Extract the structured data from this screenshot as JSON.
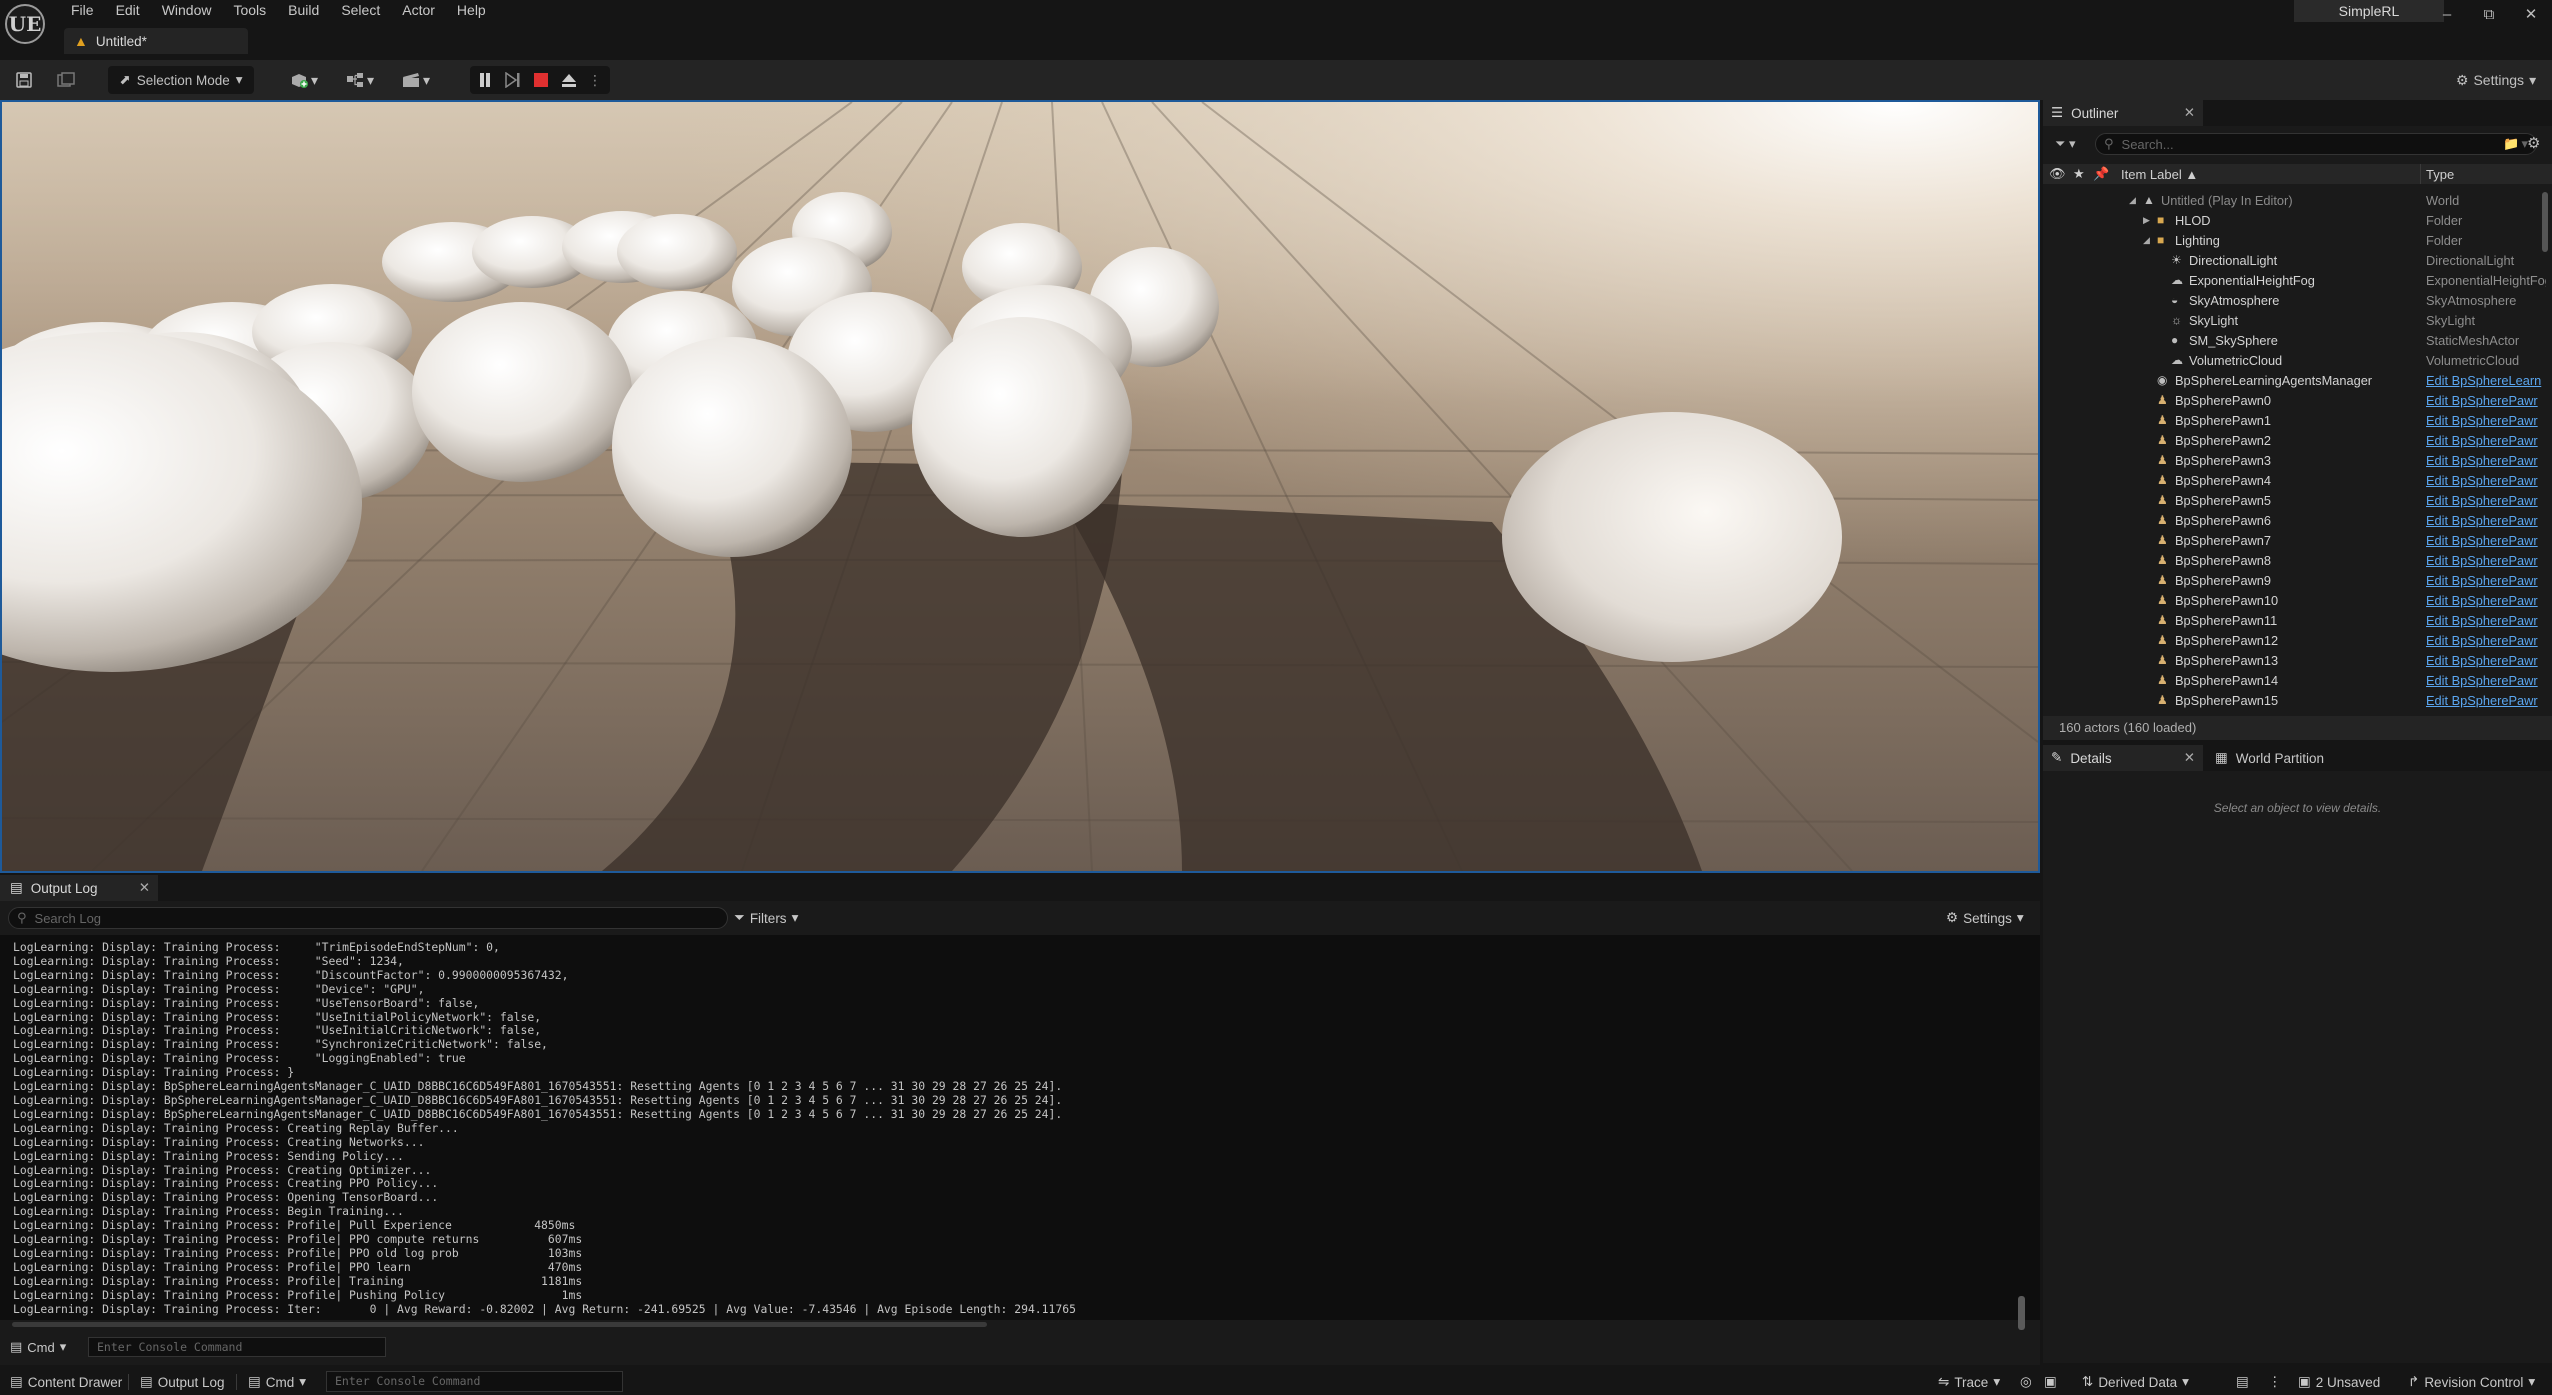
{
  "app": {
    "logo": "UE",
    "project_name": "SimpleRL",
    "document_tab": "Untitled*",
    "menu": [
      "File",
      "Edit",
      "Window",
      "Tools",
      "Build",
      "Select",
      "Actor",
      "Help"
    ],
    "window_controls": {
      "minimize": "–",
      "maximize": "⧉",
      "close": "✕"
    }
  },
  "toolbar": {
    "selection_mode": "Selection Mode",
    "settings": "Settings"
  },
  "output_log": {
    "tab_label": "Output Log",
    "search_placeholder": "Search Log",
    "filters_label": "Filters",
    "settings_label": "Settings",
    "lines": [
      "LogLearning: Display: Training Process:     \"TrimEpisodeEndStepNum\": 0,",
      "LogLearning: Display: Training Process:     \"Seed\": 1234,",
      "LogLearning: Display: Training Process:     \"DiscountFactor\": 0.9900000095367432,",
      "LogLearning: Display: Training Process:     \"Device\": \"GPU\",",
      "LogLearning: Display: Training Process:     \"UseTensorBoard\": false,",
      "LogLearning: Display: Training Process:     \"UseInitialPolicyNetwork\": false,",
      "LogLearning: Display: Training Process:     \"UseInitialCriticNetwork\": false,",
      "LogLearning: Display: Training Process:     \"SynchronizeCriticNetwork\": false,",
      "LogLearning: Display: Training Process:     \"LoggingEnabled\": true",
      "LogLearning: Display: Training Process: }",
      "LogLearning: Display: BpSphereLearningAgentsManager_C_UAID_D8BBC16C6D549FA801_1670543551: Resetting Agents [0 1 2 3 4 5 6 7 ... 31 30 29 28 27 26 25 24].",
      "LogLearning: Display: BpSphereLearningAgentsManager_C_UAID_D8BBC16C6D549FA801_1670543551: Resetting Agents [0 1 2 3 4 5 6 7 ... 31 30 29 28 27 26 25 24].",
      "LogLearning: Display: BpSphereLearningAgentsManager_C_UAID_D8BBC16C6D549FA801_1670543551: Resetting Agents [0 1 2 3 4 5 6 7 ... 31 30 29 28 27 26 25 24].",
      "LogLearning: Display: Training Process: Creating Replay Buffer...",
      "LogLearning: Display: Training Process: Creating Networks...",
      "LogLearning: Display: Training Process: Sending Policy...",
      "LogLearning: Display: Training Process: Creating Optimizer...",
      "LogLearning: Display: Training Process: Creating PPO Policy...",
      "LogLearning: Display: Training Process: Opening TensorBoard...",
      "LogLearning: Display: Training Process: Begin Training...",
      "LogLearning: Display: Training Process: Profile| Pull Experience            4850ms",
      "LogLearning: Display: Training Process: Profile| PPO compute returns          607ms",
      "LogLearning: Display: Training Process: Profile| PPO old log prob             103ms",
      "LogLearning: Display: Training Process: Profile| PPO learn                    470ms",
      "LogLearning: Display: Training Process: Profile| Training                    1181ms",
      "LogLearning: Display: Training Process: Profile| Pushing Policy                 1ms",
      "LogLearning: Display: Training Process: Iter:       0 | Avg Reward: -0.82002 | Avg Return: -241.69525 | Avg Value: -7.43546 | Avg Episode Length: 294.11765"
    ],
    "cmd_label": "Cmd",
    "console_placeholder": "Enter Console Command"
  },
  "outliner": {
    "tab_label": "Outliner",
    "search_placeholder": "Search...",
    "col_label": "Item Label ▲",
    "col_type": "Type",
    "rows": [
      {
        "label": "Untitled (Play In Editor)",
        "type": "World",
        "indent": 0,
        "kind": "world",
        "expander": "◢",
        "dim": true
      },
      {
        "label": "HLOD",
        "type": "Folder",
        "indent": 1,
        "kind": "folder",
        "expander": "▶"
      },
      {
        "label": "Lighting",
        "type": "Folder",
        "indent": 1,
        "kind": "folder",
        "expander": "◢"
      },
      {
        "label": "DirectionalLight",
        "type": "DirectionalLight",
        "indent": 2,
        "kind": "light"
      },
      {
        "label": "ExponentialHeightFog",
        "type": "ExponentialHeightFog",
        "indent": 2,
        "kind": "fog"
      },
      {
        "label": "SkyAtmosphere",
        "type": "SkyAtmosphere",
        "indent": 2,
        "kind": "sky"
      },
      {
        "label": "SkyLight",
        "type": "SkyLight",
        "indent": 2,
        "kind": "skylight"
      },
      {
        "label": "SM_SkySphere",
        "type": "StaticMeshActor",
        "indent": 2,
        "kind": "mesh"
      },
      {
        "label": "VolumetricCloud",
        "type": "VolumetricCloud",
        "indent": 2,
        "kind": "cloud"
      },
      {
        "label": "BpSphereLearningAgentsManager",
        "type": "Edit BpSphereLearn",
        "indent": 1,
        "kind": "actor",
        "link": true
      },
      {
        "label": "BpSpherePawn0",
        "type": "Edit BpSpherePawr",
        "indent": 1,
        "kind": "pawn",
        "link": true
      },
      {
        "label": "BpSpherePawn1",
        "type": "Edit BpSpherePawr",
        "indent": 1,
        "kind": "pawn",
        "link": true
      },
      {
        "label": "BpSpherePawn2",
        "type": "Edit BpSpherePawr",
        "indent": 1,
        "kind": "pawn",
        "link": true
      },
      {
        "label": "BpSpherePawn3",
        "type": "Edit BpSpherePawr",
        "indent": 1,
        "kind": "pawn",
        "link": true
      },
      {
        "label": "BpSpherePawn4",
        "type": "Edit BpSpherePawr",
        "indent": 1,
        "kind": "pawn",
        "link": true
      },
      {
        "label": "BpSpherePawn5",
        "type": "Edit BpSpherePawr",
        "indent": 1,
        "kind": "pawn",
        "link": true
      },
      {
        "label": "BpSpherePawn6",
        "type": "Edit BpSpherePawr",
        "indent": 1,
        "kind": "pawn",
        "link": true
      },
      {
        "label": "BpSpherePawn7",
        "type": "Edit BpSpherePawr",
        "indent": 1,
        "kind": "pawn",
        "link": true
      },
      {
        "label": "BpSpherePawn8",
        "type": "Edit BpSpherePawr",
        "indent": 1,
        "kind": "pawn",
        "link": true
      },
      {
        "label": "BpSpherePawn9",
        "type": "Edit BpSpherePawr",
        "indent": 1,
        "kind": "pawn",
        "link": true
      },
      {
        "label": "BpSpherePawn10",
        "type": "Edit BpSpherePawr",
        "indent": 1,
        "kind": "pawn",
        "link": true
      },
      {
        "label": "BpSpherePawn11",
        "type": "Edit BpSpherePawr",
        "indent": 1,
        "kind": "pawn",
        "link": true
      },
      {
        "label": "BpSpherePawn12",
        "type": "Edit BpSpherePawr",
        "indent": 1,
        "kind": "pawn",
        "link": true
      },
      {
        "label": "BpSpherePawn13",
        "type": "Edit BpSpherePawr",
        "indent": 1,
        "kind": "pawn",
        "link": true
      },
      {
        "label": "BpSpherePawn14",
        "type": "Edit BpSpherePawr",
        "indent": 1,
        "kind": "pawn",
        "link": true
      },
      {
        "label": "BpSpherePawn15",
        "type": "Edit BpSpherePawr",
        "indent": 1,
        "kind": "pawn",
        "link": true
      }
    ],
    "status": "160 actors (160 loaded)"
  },
  "details": {
    "tab_label": "Details",
    "tab2_label": "World Partition",
    "empty_text": "Select an object to view details."
  },
  "statusbar": {
    "content_drawer": "Content Drawer",
    "output_log": "Output Log",
    "cmd": "Cmd",
    "console_placeholder": "Enter Console Command",
    "trace": "Trace",
    "derived_data": "Derived Data",
    "unsaved": "2 Unsaved",
    "revision_control": "Revision Control"
  },
  "colors": {
    "accent_blue": "#1e5a9a",
    "link_blue": "#5aa6f0",
    "stop_red": "#e03030",
    "level_icon": "#e0a020"
  }
}
